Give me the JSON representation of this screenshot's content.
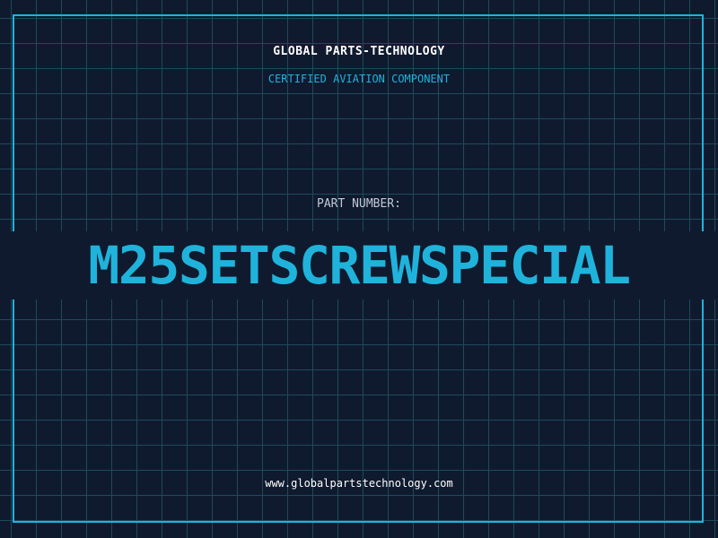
{
  "header": {
    "company_name": "GLOBAL PARTS-TECHNOLOGY",
    "subtitle": "CERTIFIED AVIATION COMPONENT"
  },
  "part": {
    "label": "PART NUMBER:",
    "number": "M25SETSCREWSPECIAL"
  },
  "footer": {
    "website": "www.globalpartstechnology.com"
  },
  "colors": {
    "background": "#101a2e",
    "grid": "#1d4a5c",
    "accent": "#1fb3dc",
    "text_primary": "#ffffff",
    "text_muted": "#c2cad6"
  }
}
